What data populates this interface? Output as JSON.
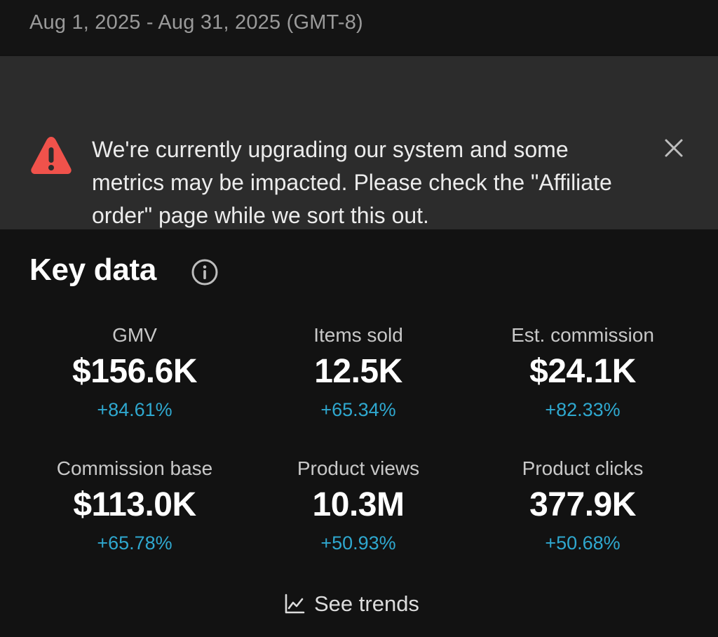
{
  "header": {
    "date_range": "Aug 1, 2025 - Aug 31, 2025 (GMT-8)"
  },
  "banner": {
    "icon": "warning-triangle-icon",
    "message": "We're currently upgrading our system and some metrics may be impacted. Please check the \"Affiliate order\" page while we sort this out.",
    "close_icon": "close-icon",
    "icon_color": "#f0524b"
  },
  "key_data": {
    "title": "Key data",
    "info_icon": "info-icon",
    "metrics": [
      {
        "label": "GMV",
        "value": "$156.6K",
        "change": "+84.61%"
      },
      {
        "label": "Items sold",
        "value": "12.5K",
        "change": "+65.34%"
      },
      {
        "label": "Est. commission",
        "value": "$24.1K",
        "change": "+82.33%"
      },
      {
        "label": "Commission base",
        "value": "$113.0K",
        "change": "+65.78%"
      },
      {
        "label": "Product views",
        "value": "10.3M",
        "change": "+50.93%"
      },
      {
        "label": "Product clicks",
        "value": "377.9K",
        "change": "+50.68%"
      }
    ],
    "change_color": "#2fa8cf",
    "see_trends": {
      "label": "See trends",
      "icon": "line-chart-icon"
    }
  }
}
